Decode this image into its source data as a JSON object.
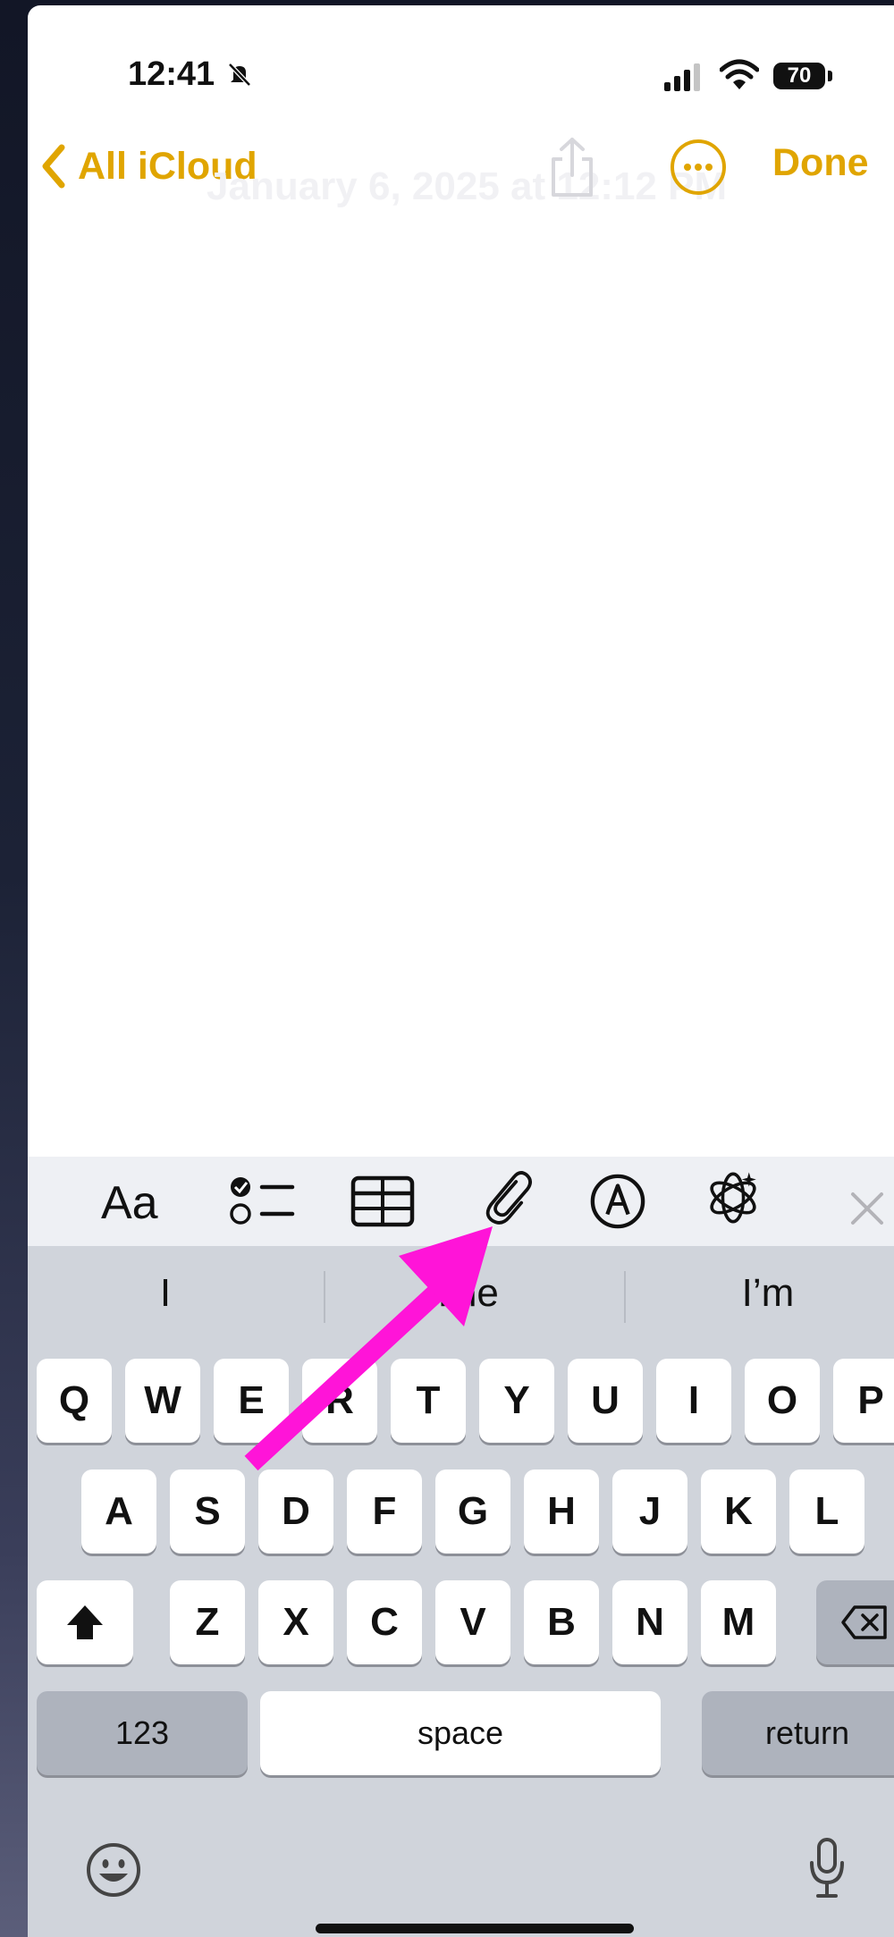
{
  "status_bar": {
    "time": "12:41",
    "battery": "70"
  },
  "nav": {
    "back_label": "All iCloud",
    "note_title": "January 6, 2025 at 12:12 PM",
    "done_label": "Done"
  },
  "toolbar": {
    "format_label": "Aa",
    "icons": [
      "checklist-icon",
      "table-icon",
      "attachment-icon",
      "markup-icon",
      "apple-intelligence-icon",
      "close-icon"
    ]
  },
  "keyboard": {
    "suggestions": [
      "I",
      "The",
      "I’m"
    ],
    "rows": [
      [
        "Q",
        "W",
        "E",
        "R",
        "T",
        "Y",
        "U",
        "I",
        "O",
        "P"
      ],
      [
        "A",
        "S",
        "D",
        "F",
        "G",
        "H",
        "J",
        "K",
        "L"
      ],
      [
        "Z",
        "X",
        "C",
        "V",
        "B",
        "N",
        "M"
      ]
    ],
    "numbers_label": "123",
    "space_label": "space",
    "return_label": "return"
  },
  "colors": {
    "accent": "#e0a500",
    "annotation": "#ff14d8"
  }
}
